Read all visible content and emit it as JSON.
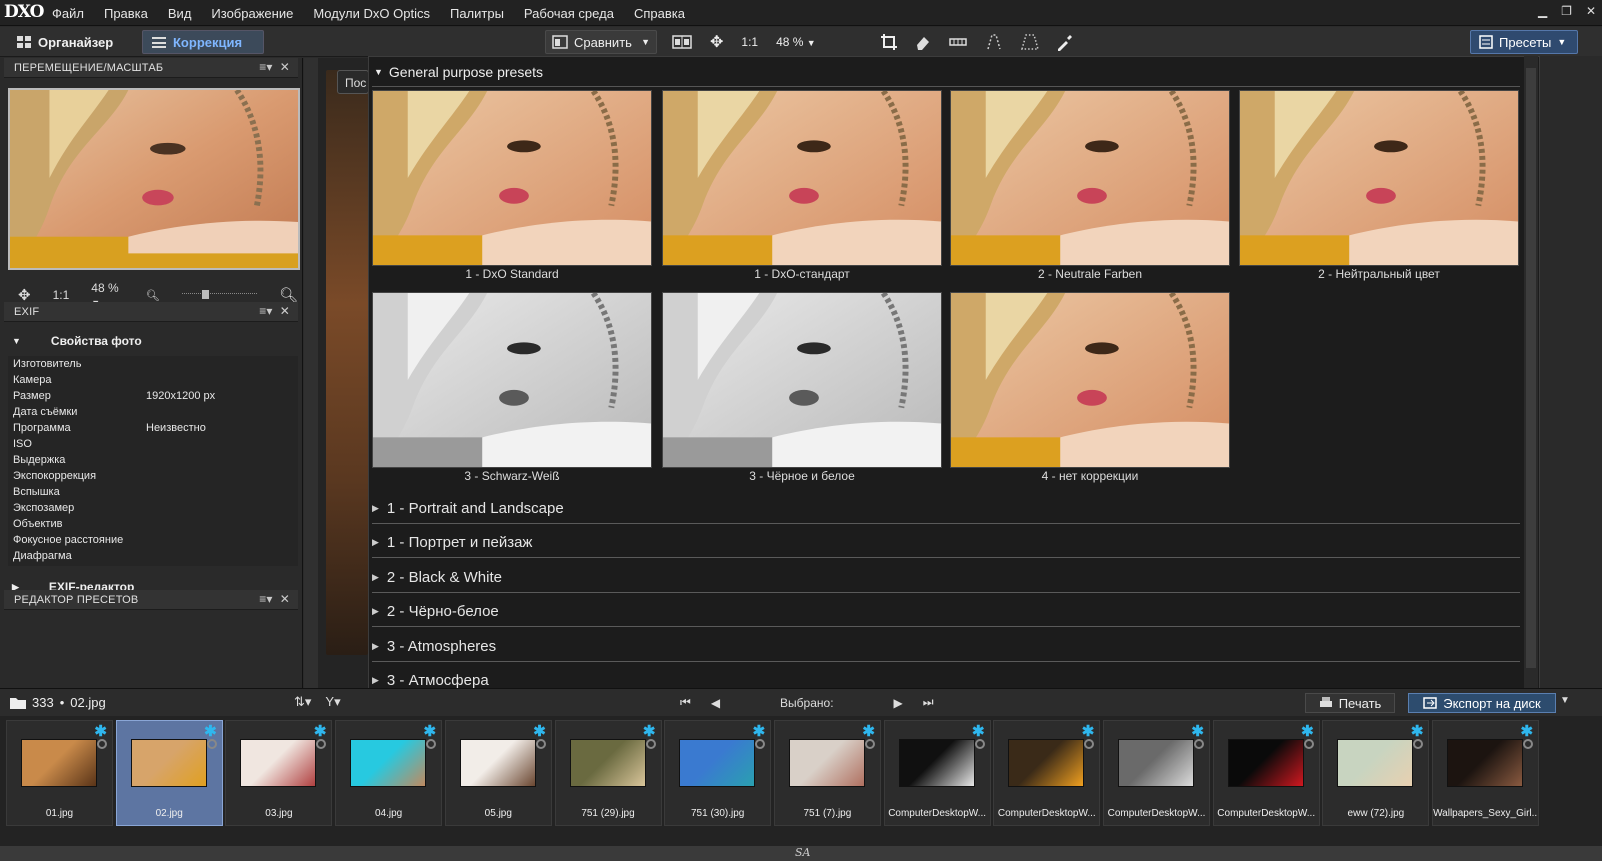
{
  "app": {
    "logo": "DXO"
  },
  "menu": [
    "Файл",
    "Правка",
    "Вид",
    "Изображение",
    "Модули DxO Optics",
    "Палитры",
    "Рабочая среда",
    "Справка"
  ],
  "toolbar": {
    "organizer": "Органайзер",
    "correction": "Коррекция",
    "compare": "Сравнить",
    "zoom_ratio": "1:1",
    "zoom_percent": "48 %",
    "presets": "Пресеты"
  },
  "left": {
    "nav_title": "ПЕРЕМЕЩЕНИЕ/МАСШТАБ",
    "nav_ratio": "1:1",
    "nav_zoom": "48 %",
    "exif_title": "EXIF",
    "exif_section": "Свойства фото",
    "exif_rows": [
      {
        "k": "Изготовитель",
        "v": ""
      },
      {
        "k": "Камера",
        "v": ""
      },
      {
        "k": "Размер",
        "v": "1920x1200 px"
      },
      {
        "k": "Дата съёмки",
        "v": ""
      },
      {
        "k": "Программа",
        "v": "Неизвестно"
      },
      {
        "k": "ISO",
        "v": ""
      },
      {
        "k": "Выдержка",
        "v": ""
      },
      {
        "k": "Экспокоррекция",
        "v": ""
      },
      {
        "k": "Вспышка",
        "v": ""
      },
      {
        "k": "Экспозамер",
        "v": ""
      },
      {
        "k": "Объектив",
        "v": ""
      },
      {
        "k": "Фокусное расстояние",
        "v": ""
      },
      {
        "k": "Диафрагма",
        "v": ""
      }
    ],
    "exif_editor": "EXIF-редактор",
    "preset_editor": "РЕДАКТОР ПРЕСЕТОВ"
  },
  "center": {
    "partial_label": "Пос"
  },
  "presets": {
    "group_title": "General purpose presets",
    "thumbs": [
      {
        "label": "1 - DxO Standard",
        "bw": false
      },
      {
        "label": "1 - DxO-стандарт",
        "bw": false
      },
      {
        "label": "2 - Neutrale Farben",
        "bw": false
      },
      {
        "label": "2 - Нейтральный цвет",
        "bw": false
      },
      {
        "label": "3 - Schwarz-Weiß",
        "bw": true
      },
      {
        "label": "3 - Чёрное и белое",
        "bw": true
      },
      {
        "label": "4 - нет коррекции",
        "bw": false
      }
    ],
    "collapsed": [
      "1 - Portrait and Landscape",
      "1 - Портрет и пейзаж",
      "2 - Black & White",
      "2 - Чёрно-белое",
      "3 - Atmospheres",
      "3 - Атмосфера"
    ]
  },
  "bottombar": {
    "folder": "333",
    "separator": "•",
    "file": "02.jpg",
    "selected_label": "Выбрано:",
    "print": "Печать",
    "export": "Экспорт на диск"
  },
  "filmstrip": [
    {
      "name": "01.jpg",
      "selected": false,
      "c1": "#c98a4a",
      "c2": "#5a3418"
    },
    {
      "name": "02.jpg",
      "selected": true,
      "c1": "#d7a46a",
      "c2": "#e0a020"
    },
    {
      "name": "03.jpg",
      "selected": false,
      "c1": "#f0e6e0",
      "c2": "#b04040"
    },
    {
      "name": "04.jpg",
      "selected": false,
      "c1": "#27c9e0",
      "c2": "#c08a60"
    },
    {
      "name": "05.jpg",
      "selected": false,
      "c1": "#f2ede8",
      "c2": "#6a4630"
    },
    {
      "name": "751 (29).jpg",
      "selected": false,
      "c1": "#6a6a40",
      "c2": "#d9c59a"
    },
    {
      "name": "751 (30).jpg",
      "selected": false,
      "c1": "#3a7ad0",
      "c2": "#2aa0b0"
    },
    {
      "name": "751 (7).jpg",
      "selected": false,
      "c1": "#d9d0c8",
      "c2": "#b07060"
    },
    {
      "name": "ComputerDesktopW...",
      "selected": false,
      "c1": "#101010",
      "c2": "#e8e8e8"
    },
    {
      "name": "ComputerDesktopW...",
      "selected": false,
      "c1": "#3a2a18",
      "c2": "#f0a020"
    },
    {
      "name": "ComputerDesktopW...",
      "selected": false,
      "c1": "#6a6a6a",
      "c2": "#dcdcdc"
    },
    {
      "name": "ComputerDesktopW...",
      "selected": false,
      "c1": "#0a0a0a",
      "c2": "#d01820"
    },
    {
      "name": "eww (72).jpg",
      "selected": false,
      "c1": "#c8d4c0",
      "c2": "#e8d0b0"
    },
    {
      "name": "Wallpapers_Sexy_Girl...",
      "selected": false,
      "c1": "#1c1410",
      "c2": "#8a5a40"
    }
  ],
  "status": {
    "text": "SA"
  },
  "colors": {
    "accent": "#2fb7ee",
    "selected_bg": "#5d75a2",
    "preset_btn": "#2f4a6f"
  }
}
